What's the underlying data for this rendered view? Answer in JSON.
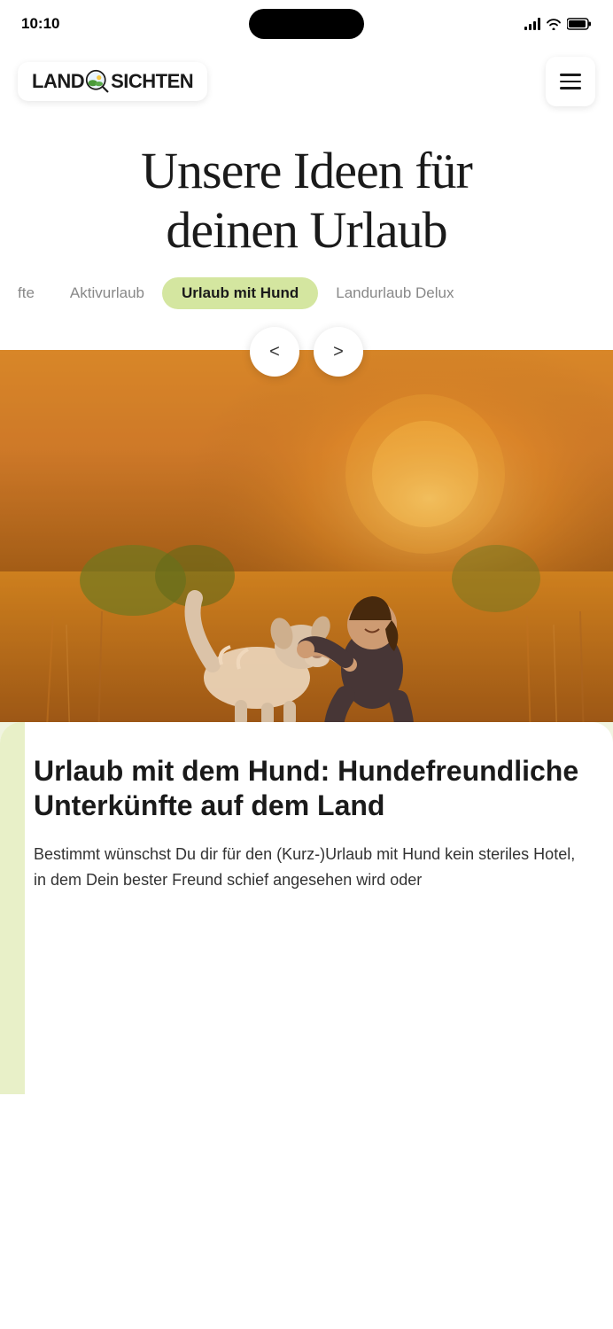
{
  "statusBar": {
    "time": "10:10",
    "signalLabel": "signal",
    "wifiLabel": "wifi",
    "batteryLabel": "battery"
  },
  "header": {
    "logoTextLeft": "LAND",
    "logoTextRight": "SICHTEN",
    "menuButtonLabel": "Menu"
  },
  "hero": {
    "title": "Unsere Ideen für\ndeinen Urlaub"
  },
  "tabs": [
    {
      "id": "tab-fte",
      "label": "fte",
      "active": false
    },
    {
      "id": "tab-aktivurlaub",
      "label": "Aktivurlaub",
      "active": false
    },
    {
      "id": "tab-urlaub-mit-hund",
      "label": "Urlaub mit Hund",
      "active": true
    },
    {
      "id": "tab-landurlaub-delux",
      "label": "Landurlaub Delux",
      "active": false
    }
  ],
  "carousel": {
    "prevLabel": "<",
    "nextLabel": ">"
  },
  "article": {
    "title": "Urlaub mit dem Hund: Hundefreundliche Unterkünfte auf dem Land",
    "body": "Bestimmt wünschst Du dir für den (Kurz-)Urlaub mit Hund kein steriles Hotel, in dem Dein bester Freund schief angesehen wird oder"
  }
}
